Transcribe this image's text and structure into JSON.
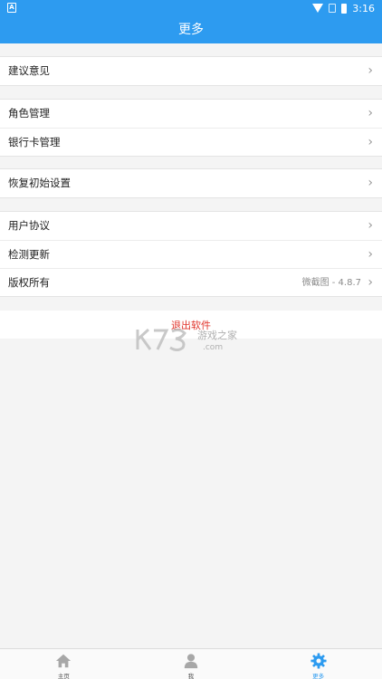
{
  "status_bar": {
    "left_glyph": "A",
    "time": "3:16"
  },
  "header": {
    "title": "更多"
  },
  "groups": [
    {
      "items": [
        {
          "label": "建议意见"
        }
      ]
    },
    {
      "items": [
        {
          "label": "角色管理"
        },
        {
          "label": "银行卡管理"
        }
      ]
    },
    {
      "items": [
        {
          "label": "恢复初始设置"
        }
      ]
    },
    {
      "items": [
        {
          "label": "用户协议"
        },
        {
          "label": "检测更新"
        },
        {
          "label": "版权所有",
          "value": "微截图 - 4.8.7"
        }
      ]
    }
  ],
  "logout_label": "退出软件",
  "watermark": {
    "logo": "K73",
    "text": "游戏之家",
    "sub": ".com"
  },
  "tabbar": {
    "items": [
      {
        "label": "主页",
        "icon": "home-icon"
      },
      {
        "label": "我",
        "icon": "user-icon"
      },
      {
        "label": "更多",
        "icon": "gear-icon"
      }
    ]
  },
  "colors": {
    "primary": "#2d9bf0",
    "danger": "#e0342b"
  }
}
